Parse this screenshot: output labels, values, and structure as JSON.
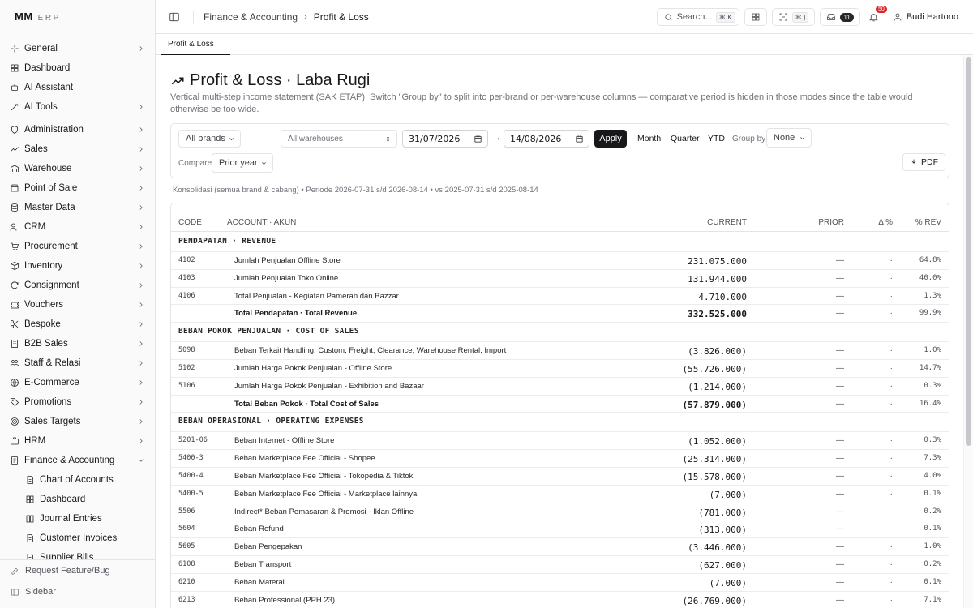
{
  "app": {
    "logo_mark": "MM",
    "logo_text": "ERP"
  },
  "sidebar": {
    "items": [
      {
        "label": "General",
        "icon": "spark-icon",
        "chevron": "right"
      },
      {
        "label": "Dashboard",
        "icon": "grid-icon",
        "chevron": ""
      },
      {
        "label": "AI Assistant",
        "icon": "bot-icon",
        "chevron": ""
      },
      {
        "label": "AI Tools",
        "icon": "wand-icon",
        "chevron": "right"
      },
      {
        "label": "Administration",
        "icon": "shield-icon",
        "chevron": "right"
      },
      {
        "label": "Sales",
        "icon": "trend-icon",
        "chevron": "right"
      },
      {
        "label": "Warehouse",
        "icon": "warehouse-icon",
        "chevron": "right"
      },
      {
        "label": "Point of Sale",
        "icon": "store-icon",
        "chevron": "right"
      },
      {
        "label": "Master Data",
        "icon": "database-icon",
        "chevron": "right"
      },
      {
        "label": "CRM",
        "icon": "users-icon",
        "chevron": "right"
      },
      {
        "label": "Procurement",
        "icon": "cart-icon",
        "chevron": "right"
      },
      {
        "label": "Inventory",
        "icon": "box-icon",
        "chevron": "right"
      },
      {
        "label": "Consignment",
        "icon": "refresh-icon",
        "chevron": "right"
      },
      {
        "label": "Vouchers",
        "icon": "ticket-icon",
        "chevron": "right"
      },
      {
        "label": "Bespoke",
        "icon": "scissors-icon",
        "chevron": "right"
      },
      {
        "label": "B2B Sales",
        "icon": "building-icon",
        "chevron": "right"
      },
      {
        "label": "Staff & Relasi",
        "icon": "people-icon",
        "chevron": "right"
      },
      {
        "label": "E-Commerce",
        "icon": "globe-icon",
        "chevron": "right"
      },
      {
        "label": "Promotions",
        "icon": "tag-icon",
        "chevron": "right"
      },
      {
        "label": "Sales Targets",
        "icon": "target-icon",
        "chevron": "right"
      },
      {
        "label": "HRM",
        "icon": "briefcase-icon",
        "chevron": "right"
      },
      {
        "label": "Finance & Accounting",
        "icon": "ledger-icon",
        "chevron": "down"
      }
    ],
    "sub_items": [
      {
        "label": "Chart of Accounts",
        "icon": "doc-icon"
      },
      {
        "label": "Dashboard",
        "icon": "grid-icon"
      },
      {
        "label": "Journal Entries",
        "icon": "book-icon"
      },
      {
        "label": "Customer Invoices",
        "icon": "doc-icon"
      },
      {
        "label": "Supplier Bills",
        "icon": "doc-icon"
      }
    ],
    "footer": {
      "request": "Request Feature/Bug",
      "sidebar": "Sidebar"
    }
  },
  "header": {
    "breadcrumb": [
      "Finance & Accounting",
      "Profit & Loss"
    ],
    "search_label": "Search...",
    "search_kbd": "⌘ K",
    "cmd_kbd": "⌘ J",
    "inbox_count": "11",
    "notif_count": "50",
    "user_name": "Budi Hartono"
  },
  "tabs": [
    {
      "label": "Profit & Loss"
    }
  ],
  "page": {
    "title": "Profit & Loss · Laba Rugi",
    "subtitle": "Vertical multi-step income statement (SAK ETAP). Switch \"Group by\" to split into per-brand or per-warehouse columns — comparative period is hidden in those modes since the table would otherwise be too wide."
  },
  "filters": {
    "brand": "All brands",
    "warehouse": "All warehouses",
    "date_from": "31/07/2026",
    "date_to": "14/08/2026",
    "apply": "Apply",
    "presets": [
      "Month",
      "Quarter",
      "YTD"
    ],
    "group_by_label": "Group by",
    "group_by": "None",
    "compare_label": "Compare",
    "compare": "Prior year",
    "pdf": "PDF"
  },
  "meta": "Konsolidasi (semua brand & cabang) • Periode 2026-07-31 s/d 2026-08-14 • vs 2025-07-31 s/d 2025-08-14",
  "table": {
    "headers": {
      "code": "CODE",
      "account": "ACCOUNT · AKUN",
      "current": "CURRENT",
      "prior": "PRIOR",
      "delta": "Δ %",
      "rev": "% REV"
    },
    "rows": [
      {
        "type": "section",
        "label": "PENDAPATAN · REVENUE"
      },
      {
        "type": "line",
        "code": "4102",
        "account": "Jumlah Penjualan Offline Store",
        "current": "231.075.000",
        "prior": "—",
        "delta": "·",
        "rev": "64.8%"
      },
      {
        "type": "line",
        "code": "4103",
        "account": "Jumlah Penjualan Toko Online",
        "current": "131.944.000",
        "prior": "—",
        "delta": "·",
        "rev": "40.0%"
      },
      {
        "type": "line",
        "code": "4106",
        "account": "Total Penjualan - Kegiatan Pameran dan Bazzar",
        "current": "4.710.000",
        "prior": "—",
        "delta": "·",
        "rev": "1.3%"
      },
      {
        "type": "total",
        "code": "",
        "account": "Total Pendapatan · Total Revenue",
        "current": "332.525.000",
        "prior": "—",
        "delta": "·",
        "rev": "99.9%"
      },
      {
        "type": "section",
        "label": "BEBAN POKOK PENJUALAN · COST OF SALES"
      },
      {
        "type": "line",
        "code": "5098",
        "account": "Beban Terkait Handling, Custom, Freight, Clearance, Warehouse Rental, Import",
        "current": "(3.826.000)",
        "prior": "—",
        "delta": "·",
        "rev": "1.0%"
      },
      {
        "type": "line",
        "code": "5102",
        "account": "Jumlah Harga Pokok Penjualan - Offline Store",
        "current": "(55.726.000)",
        "prior": "—",
        "delta": "·",
        "rev": "14.7%"
      },
      {
        "type": "line",
        "code": "5106",
        "account": "Jumlah Harga Pokok Penjualan - Exhibition and Bazaar",
        "current": "(1.214.000)",
        "prior": "—",
        "delta": "·",
        "rev": "0.3%"
      },
      {
        "type": "total",
        "code": "",
        "account": "Total Beban Pokok · Total Cost of Sales",
        "current": "(57.879.000)",
        "prior": "—",
        "delta": "·",
        "rev": "16.4%"
      },
      {
        "type": "section",
        "label": "BEBAN OPERASIONAL · OPERATING EXPENSES"
      },
      {
        "type": "line",
        "code": "5201-06",
        "account": "Beban Internet - Offline Store",
        "current": "(1.052.000)",
        "prior": "—",
        "delta": "·",
        "rev": "0.3%"
      },
      {
        "type": "line",
        "code": "5400-3",
        "account": "Beban Marketplace Fee Official - Shopee",
        "current": "(25.314.000)",
        "prior": "—",
        "delta": "·",
        "rev": "7.3%"
      },
      {
        "type": "line",
        "code": "5400-4",
        "account": "Beban Marketplace Fee Official - Tokopedia & Tiktok",
        "current": "(15.578.000)",
        "prior": "—",
        "delta": "·",
        "rev": "4.0%"
      },
      {
        "type": "line",
        "code": "5400-5",
        "account": "Beban Marketplace Fee Official - Marketplace lainnya",
        "current": "(7.000)",
        "prior": "—",
        "delta": "·",
        "rev": "0.1%"
      },
      {
        "type": "line",
        "code": "5506",
        "account": "Indirect* Beban Pemasaran & Promosi - Iklan Offline",
        "current": "(781.000)",
        "prior": "—",
        "delta": "·",
        "rev": "0.2%"
      },
      {
        "type": "line",
        "code": "5604",
        "account": "Beban Refund",
        "current": "(313.000)",
        "prior": "—",
        "delta": "·",
        "rev": "0.1%"
      },
      {
        "type": "line",
        "code": "5605",
        "account": "Beban Pengepakan",
        "current": "(3.446.000)",
        "prior": "—",
        "delta": "·",
        "rev": "1.0%"
      },
      {
        "type": "line",
        "code": "6108",
        "account": "Beban Transport",
        "current": "(627.000)",
        "prior": "—",
        "delta": "·",
        "rev": "0.2%"
      },
      {
        "type": "line",
        "code": "6210",
        "account": "Beban Materai",
        "current": "(7.000)",
        "prior": "—",
        "delta": "·",
        "rev": "0.1%"
      },
      {
        "type": "line",
        "code": "6213",
        "account": "Beban Professional (PPH 23)",
        "current": "(26.769.000)",
        "prior": "—",
        "delta": "·",
        "rev": "7.1%"
      }
    ]
  }
}
